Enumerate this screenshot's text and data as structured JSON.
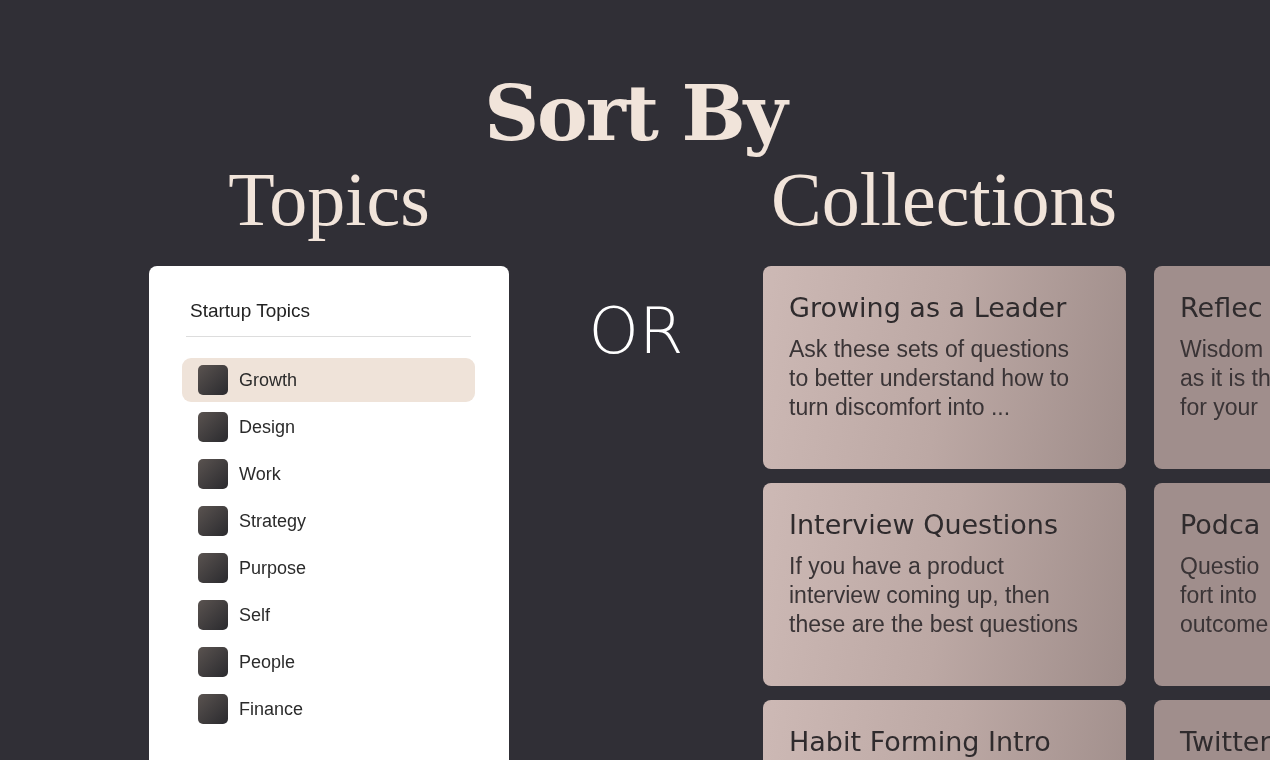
{
  "heading": "Sort By",
  "topics_heading": "Topics",
  "separator": "OR",
  "collections_heading": "Collections",
  "topics_panel": {
    "title": "Startup Topics",
    "items": [
      {
        "label": "Growth",
        "selected": true
      },
      {
        "label": "Design",
        "selected": false
      },
      {
        "label": "Work",
        "selected": false
      },
      {
        "label": "Strategy",
        "selected": false
      },
      {
        "label": "Purpose",
        "selected": false
      },
      {
        "label": "Self",
        "selected": false
      },
      {
        "label": "People",
        "selected": false
      },
      {
        "label": "Finance",
        "selected": false
      }
    ]
  },
  "collections": [
    {
      "title": "Growing as a Leader",
      "description_lines": [
        "Ask these sets of questions",
        "to better understand how to",
        "turn discomfort into ..."
      ]
    },
    {
      "title": "Reflec",
      "description_lines": [
        "Wisdom",
        "as it is th",
        "for your"
      ]
    },
    {
      "title": "Interview Questions",
      "description_lines": [
        "If you have a product",
        "interview coming up, then",
        "these are the best questions"
      ]
    },
    {
      "title": "Podca",
      "description_lines": [
        "Questio",
        "fort into",
        "outcome"
      ]
    },
    {
      "title": "Habit Forming Intro"
    },
    {
      "title": "Twitter"
    }
  ]
}
